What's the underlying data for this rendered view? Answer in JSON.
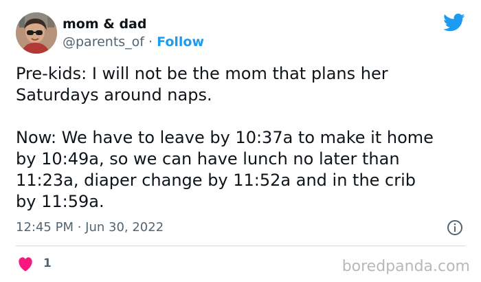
{
  "author": {
    "display_name": "mom & dad",
    "handle": "@parents_of",
    "separator": "·",
    "follow_label": "Follow"
  },
  "tweet": {
    "text": "Pre-kids: I will not be the mom that plans her\nSaturdays around naps.\n\nNow: We have to leave by 10:37a to make it home\nby 10:49a, so we can have lunch no later than\n11:23a, diaper change by 11:52a and in the crib\nby 11:59a.",
    "timestamp": "12:45 PM · Jun 30, 2022"
  },
  "engagement": {
    "like_count": "1"
  },
  "watermark": "boredpanda.com",
  "icons": {
    "brand": "twitter-bird-icon",
    "info": "info-icon",
    "like": "heart-icon"
  },
  "colors": {
    "accent": "#1d9bf0",
    "secondary_text": "#536471",
    "like": "#f91880",
    "watermark": "#b8b8b8"
  }
}
